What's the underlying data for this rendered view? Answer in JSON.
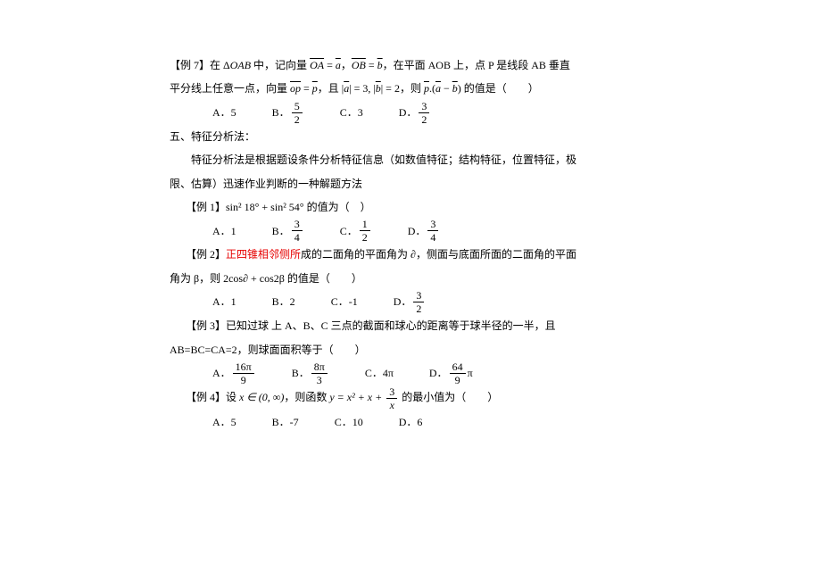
{
  "p7": {
    "prefix": "【例 7】在 Δ",
    "oab": "OAB",
    "mid1": " 中，记向量 ",
    "oa": "OA",
    "eq1": " = ",
    "a": "a",
    "comma": "，",
    "ob": "OB",
    "b": "b",
    "after": "，在平面 AOB 上，点 P 是线段 AB 垂直",
    "line2a": "平分线上任意一点，向量 ",
    "op": "op",
    "p": "p",
    "line2b": "，且 |",
    "line2c": "| = 3, |",
    "line2d": "| = 2，则 ",
    "dot": ".(",
    "minus": " − ",
    "end": ") 的值是（　　）",
    "opts": {
      "A": "A．5",
      "B": "B．",
      "Bnum": "5",
      "Bden": "2",
      "C": "C．3",
      "D": "D．",
      "Dnum": "3",
      "Dden": "2"
    }
  },
  "section5": {
    "title": "五、特征分析法：",
    "desc1": "　　特征分析法是根据题设条件分析特征信息（如数值特征；结构特征，位置特征，极",
    "desc2": "限、估算）迅速作业判断的一种解题方法"
  },
  "p1": {
    "prefix": "　　【例 1】",
    "expr": "sin² 18° + sin² 54° ",
    "suffix": "的值为（　）",
    "opts": {
      "A": "A．1",
      "B": "B．",
      "Bnum": "3",
      "Bden": "4",
      "C": "C．",
      "Cnum": "1",
      "Cden": "2",
      "D": "D．",
      "Dnum": "3",
      "Dden": "4"
    }
  },
  "p2": {
    "pre": "　　【例 2】",
    "red": "正四锥相邻侧所",
    "post1": "成的二面角的平面角为 ∂，侧面与底面所面的二面角的平面",
    "line2": "角为 β，则 2cos∂ + cos2β 的值是（　　）",
    "opts": {
      "A": "A．1",
      "B": "B．2",
      "C": "C．-1",
      "D": "D．",
      "Dnum": "3",
      "Dden": "2"
    }
  },
  "p3": {
    "line1": "　　【例 3】已知过球  上 A、B、C 三点的截面和球心的距离等于球半径的一半，且",
    "line2": "AB=BC=CA=2，则球面面积等于（　　）",
    "opts": {
      "A": "A．",
      "Anum": "16π",
      "Aden": "9",
      "B": "B．",
      "Bnum": "8π",
      "Bden": "3",
      "C": "C．4π",
      "D": "D．",
      "Dnum": "64",
      "Dden": "9",
      "Dpost": "π"
    }
  },
  "p4": {
    "pre": "　　【例 4】设 ",
    "xin": "x ∈ (0, ∞)",
    "mid": "，则函数 ",
    "fn1": "y = x² + x + ",
    "fnum": "3",
    "fden": "x",
    "post": " 的最小值为（　　）",
    "opts": {
      "A": "A．5",
      "B": "B．-7",
      "C": "C．10",
      "D": "D．6"
    }
  }
}
